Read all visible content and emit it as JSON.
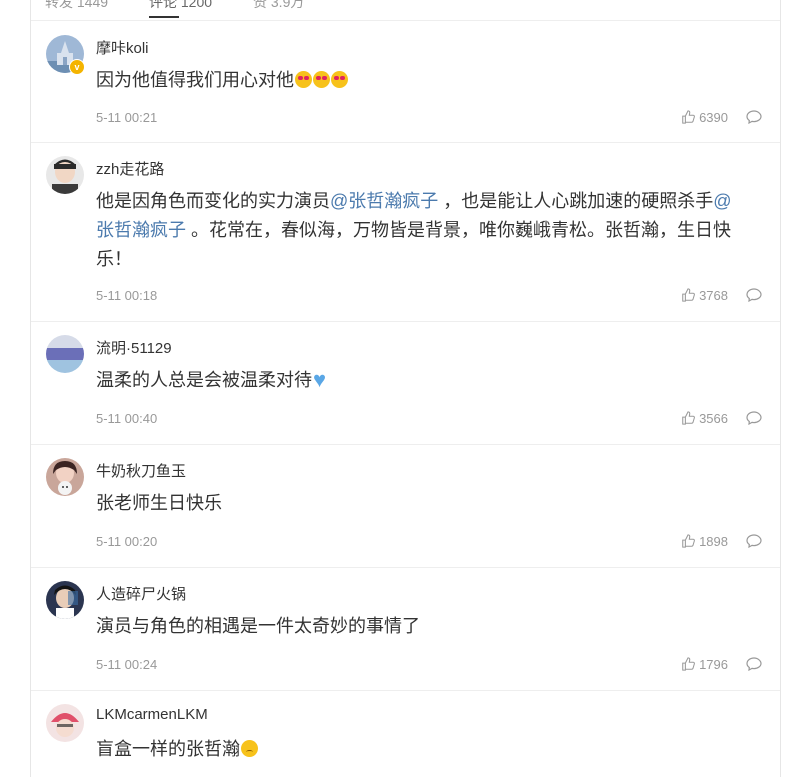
{
  "tabs": [
    {
      "label": "转发 1449"
    },
    {
      "label": "评论 1200"
    },
    {
      "label": "赞 3.9万"
    }
  ],
  "comments": [
    {
      "username": "摩咔koli",
      "verified": true,
      "text_plain": "因为他值得我们用心对他",
      "emoji": "heart-eyes x3",
      "time": "5-11 00:21",
      "likes": "6390"
    },
    {
      "username": "zzh走花路",
      "verified": false,
      "text_1": "他是因角色而变化的实力演员",
      "mention": "@张哲瀚疯子",
      "text_2": " ，也是能让人心跳加速的硬照杀手",
      "text_3": " 。花常在，春似海，万物皆是背景，唯你巍峨青松。张哲瀚，生日快乐！",
      "time": "5-11 00:18",
      "likes": "3768"
    },
    {
      "username": "流明·51129",
      "verified": false,
      "text_plain": "温柔的人总是会被温柔对待",
      "emoji": "blue-heart",
      "time": "5-11 00:40",
      "likes": "3566"
    },
    {
      "username": "牛奶秋刀鱼玉",
      "verified": false,
      "text_plain": "张老师生日快乐",
      "time": "5-11 00:20",
      "likes": "1898"
    },
    {
      "username": "人造碎尸火锅",
      "verified": false,
      "text_plain": "演员与角色的相遇是一件太奇妙的事情了",
      "time": "5-11 00:24",
      "likes": "1796"
    },
    {
      "username": "LKMcarmenLKM",
      "verified": false,
      "text_plain": "盲盒一样的张哲瀚",
      "emoji": "worried-face"
    }
  ],
  "icons": {
    "like": "thumbs-up-icon",
    "reply": "speech-bubble-icon",
    "verified": "verified-badge-icon"
  },
  "colors": {
    "mention": "#4b7aad",
    "meta_text": "#999999",
    "verified_badge": "#f4b400"
  }
}
